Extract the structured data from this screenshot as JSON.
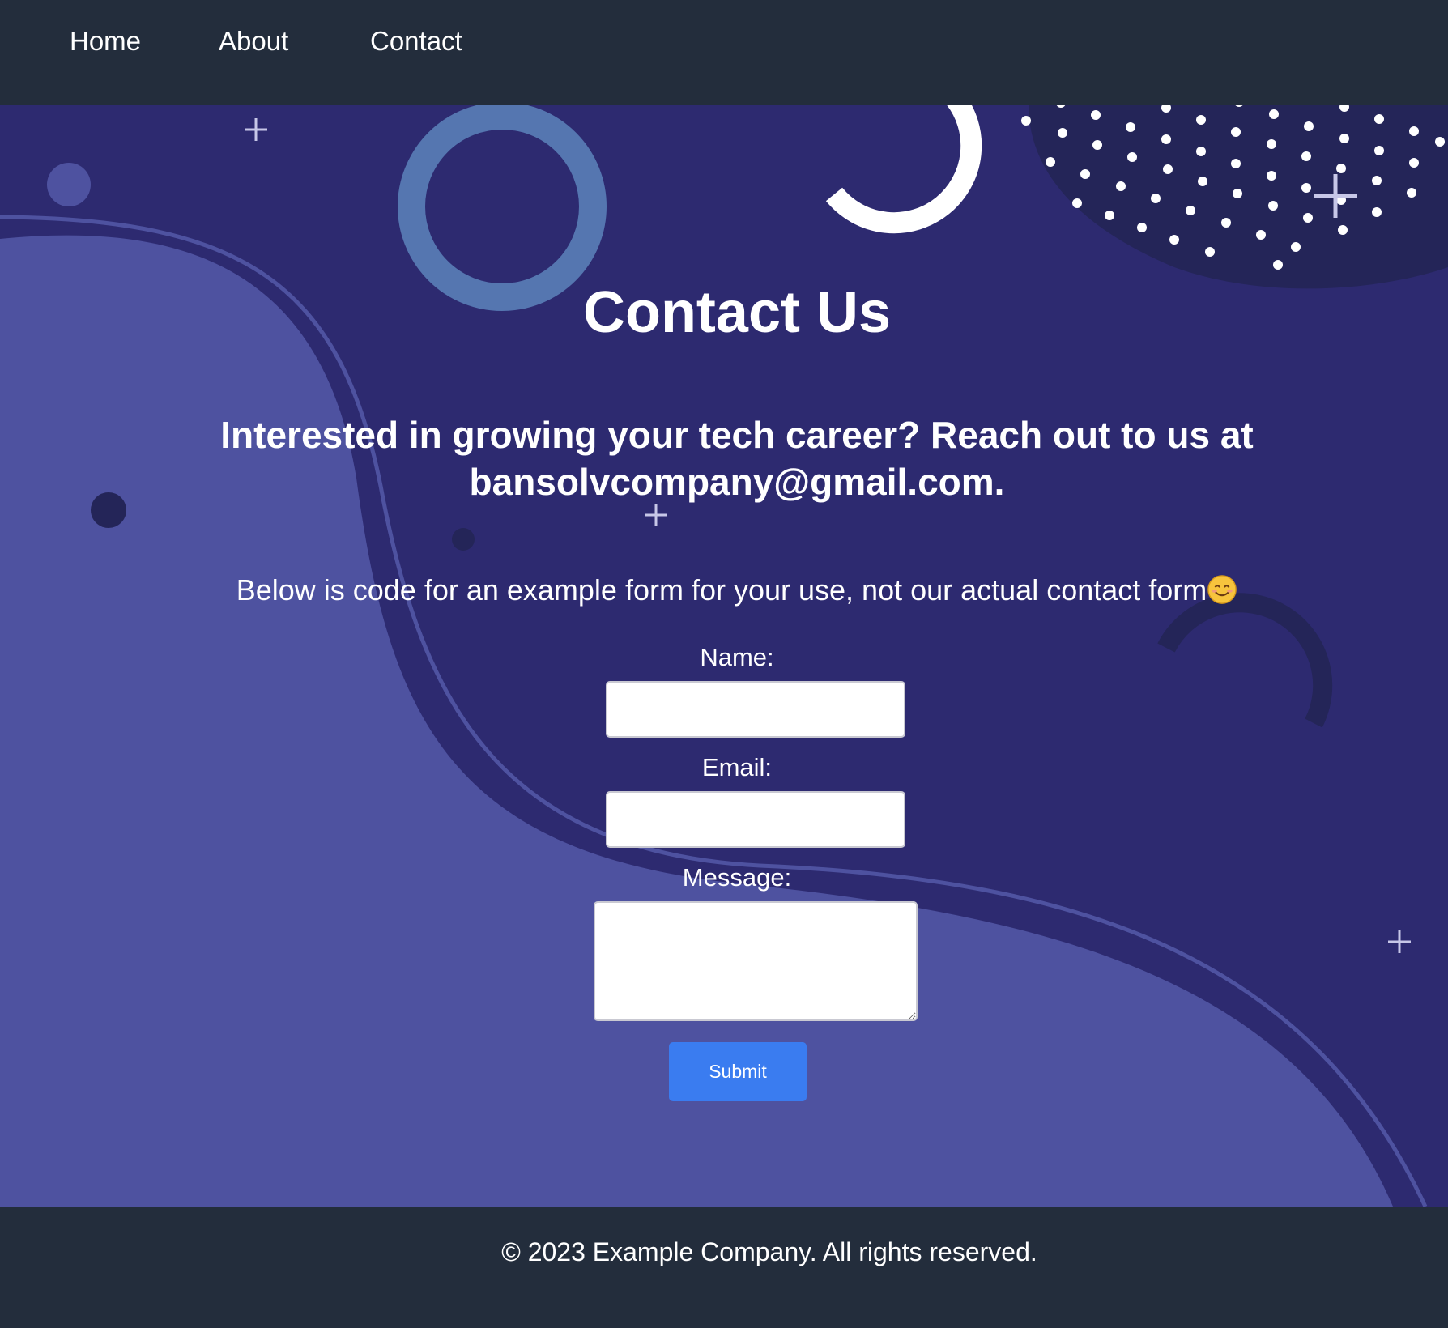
{
  "nav": {
    "items": [
      {
        "label": "Home"
      },
      {
        "label": "About"
      },
      {
        "label": "Contact"
      }
    ]
  },
  "main": {
    "title": "Contact Us",
    "subtitle": "Interested in growing your tech career? Reach out to us at bansolvcompany@gmail.com.",
    "note": "Below is code for an example form for your use, not our actual contact form",
    "note_emoji": "smiling-face-icon"
  },
  "form": {
    "name_label": "Name:",
    "name_value": "",
    "email_label": "Email:",
    "email_value": "",
    "message_label": "Message:",
    "message_value": "",
    "submit_label": "Submit"
  },
  "footer": {
    "text": "© 2023 Example Company. All rights reserved."
  },
  "colors": {
    "nav_bg": "#232d3c",
    "hero_bg": "#2d2a70",
    "hero_wave": "#4e52a0",
    "ring": "#5576b0",
    "submit_bg": "#3a7cf0"
  }
}
